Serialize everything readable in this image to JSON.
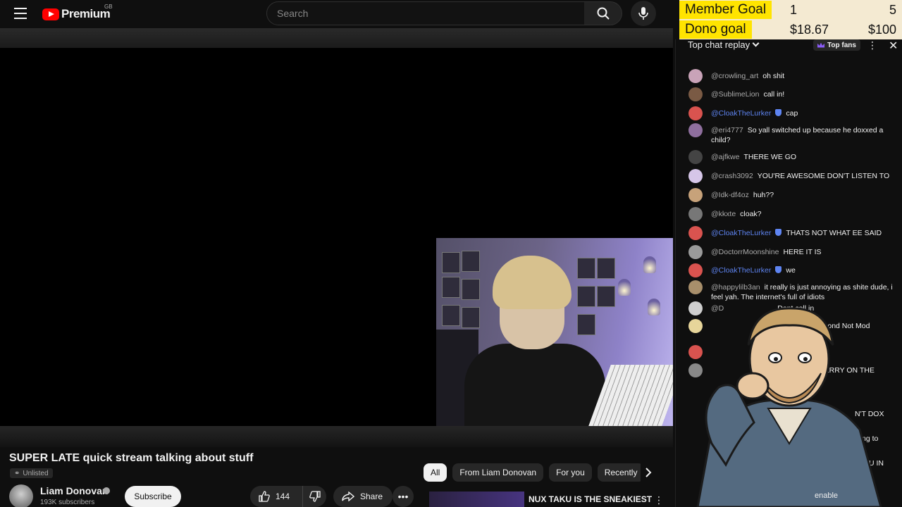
{
  "header": {
    "logo_text": "Premium",
    "region": "GB",
    "search_placeholder": "Search"
  },
  "goals": {
    "member": {
      "label": "Member Goal",
      "current": "1",
      "target": "5"
    },
    "dono": {
      "label": "Dono goal",
      "current": "$18.67",
      "target": "$100"
    }
  },
  "video": {
    "title": "SUPER LATE quick stream talking about stuff",
    "visibility": "Unlisted",
    "channel": "Liam Donovan",
    "subscribers": "193K subscribers",
    "subscribe_label": "Subscribe",
    "likes": "144",
    "share_label": "Share"
  },
  "chips": [
    "All",
    "From Liam Donovan",
    "For you",
    "Recently"
  ],
  "recommended": {
    "title": "NUX TAKU IS THE SNEAKIEST"
  },
  "chat": {
    "mode": "Top chat replay",
    "top_fans": "Top fans",
    "messages": [
      {
        "user": "@crowling_art",
        "text": "oh shit",
        "mod": false,
        "color": "#c9a3b8"
      },
      {
        "user": "@SublimeLion",
        "text": "call in!",
        "mod": false,
        "color": "#7a5a44"
      },
      {
        "user": "@CloakTheLurker",
        "text": "cap",
        "mod": true,
        "color": "#d9534f"
      },
      {
        "user": "@eri4777",
        "text": "So yall switched up because he doxxed a child?",
        "mod": false,
        "color": "#8f6f9e"
      },
      {
        "user": "@ajfkwe",
        "text": "THERE WE GO",
        "mod": false,
        "color": "#444444"
      },
      {
        "user": "@crash3092",
        "text": "YOU'RE AWESOME DON'T LISTEN TO",
        "mod": false,
        "color": "#d6c6e8"
      },
      {
        "user": "@Idk-df4oz",
        "text": "huh??",
        "mod": false,
        "color": "#c7a27a"
      },
      {
        "user": "@kkxte",
        "text": "cloak?",
        "mod": false,
        "color": "#777777"
      },
      {
        "user": "@CloakTheLurker",
        "text": "THATS NOT WHAT EE SAID",
        "mod": true,
        "color": "#d9534f"
      },
      {
        "user": "@DoctorrMoonshine",
        "text": "HERE IT IS",
        "mod": false,
        "color": "#9a9a9a"
      },
      {
        "user": "@CloakTheLurker",
        "text": "we",
        "mod": true,
        "color": "#d9534f"
      },
      {
        "user": "@happylilb3an",
        "text": "it really is just annoying as shite dude, i feel yah. The internet's full of idiots",
        "mod": false,
        "color": "#a88f6b"
      }
    ],
    "partial_texts": [
      "Dont call in",
      "uld Blue Diamond Not Mod",
      "k bue",
      "ET STRAWBERRY ON THE",
      "N'T DOX",
      "ng to",
      "U IN",
      "enable"
    ]
  }
}
